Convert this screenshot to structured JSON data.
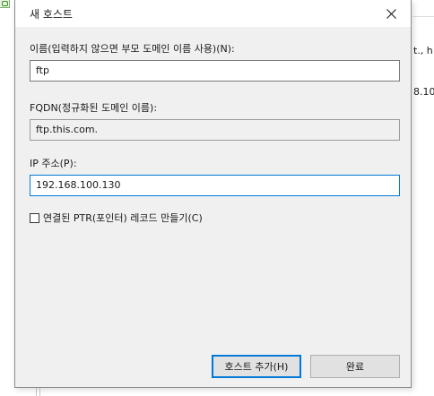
{
  "background_window": {
    "text_line_1": "t., h",
    "text_line_2": "8.10"
  },
  "dialog": {
    "title": "새 호스트",
    "close_icon": "close-icon",
    "name_label": "이름(입력하지 않으면 부모 도메인 이름 사용)(N):",
    "name_value": "ftp",
    "fqdn_label": "FQDN(정규화된 도메인 이름):",
    "fqdn_value": "ftp.this.com.",
    "ip_label": "IP 주소(P):",
    "ip_value": "192.168.100.130",
    "ptr_checkbox_label": "연결된 PTR(포인터) 레코드 만들기(C)",
    "ptr_checked": false,
    "add_host_button": "호스트 추가(H)",
    "done_button": "완료"
  },
  "colors": {
    "accent": "#0078d7",
    "dialog_bg": "#f0f0f0",
    "button_bg": "#e1e1e1"
  }
}
